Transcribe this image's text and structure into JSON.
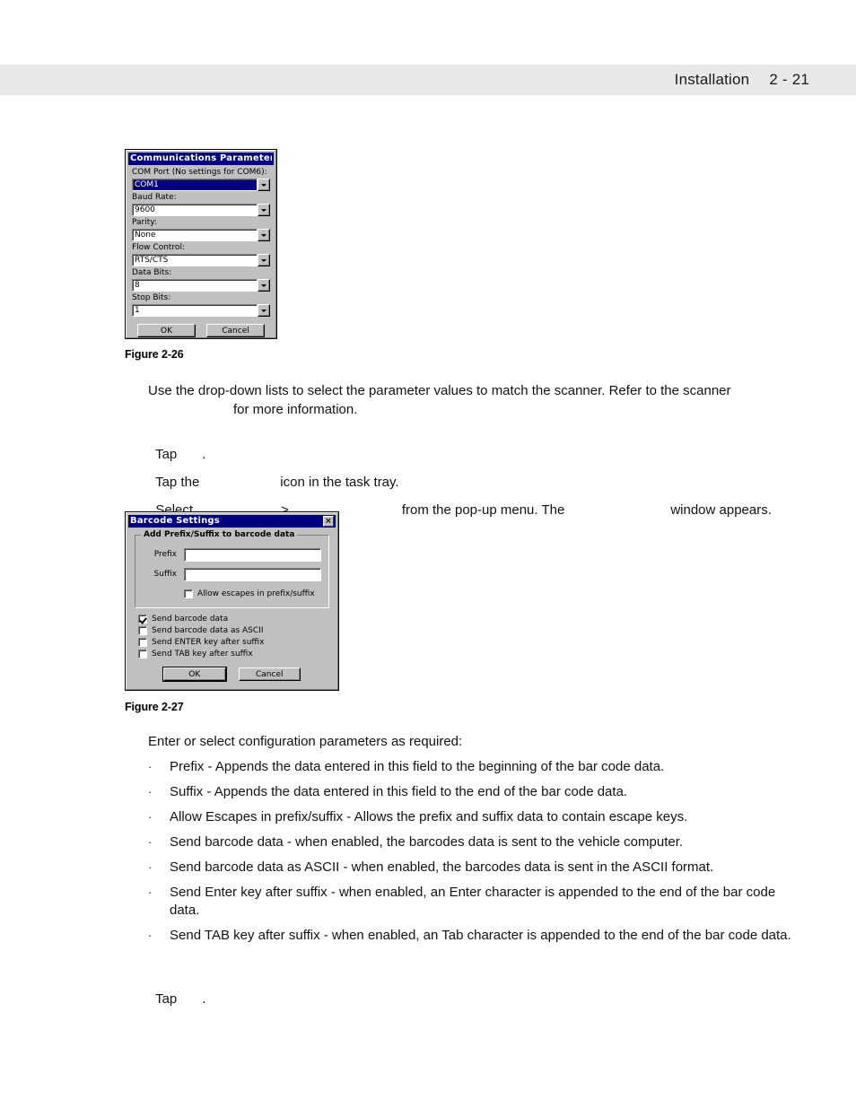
{
  "header": {
    "title": "Installation",
    "folio": "2 - 21"
  },
  "figure_comms": {
    "caption": "Figure 2-26",
    "titlebar": "Communications Parameters",
    "fields": [
      {
        "label": "COM Port (No settings for COM6):",
        "value": "COM1",
        "selected": true
      },
      {
        "label": "Baud Rate:",
        "value": "9600",
        "selected": false
      },
      {
        "label": "Parity:",
        "value": "None",
        "selected": false
      },
      {
        "label": "Flow Control:",
        "value": "RTS/CTS",
        "selected": false
      },
      {
        "label": "Data Bits:",
        "value": "8",
        "selected": false
      },
      {
        "label": "Stop Bits:",
        "value": "1",
        "selected": false
      }
    ],
    "buttons": {
      "ok": "OK",
      "cancel": "Cancel"
    }
  },
  "figure_barcode": {
    "caption": "Figure 2-27",
    "titlebar": "Barcode Settings",
    "close_glyph": "×",
    "group_title": "Add Prefix/Suffix to barcode data",
    "prefix_label": "Prefix",
    "prefix_value": "",
    "suffix_label": "Suffix",
    "suffix_value": "",
    "allow_escapes_label": "Allow escapes in prefix/suffix",
    "allow_escapes_checked": false,
    "checkboxes": [
      {
        "label": "Send barcode data",
        "checked": true
      },
      {
        "label": "Send barcode data as ASCII",
        "checked": false
      },
      {
        "label": "Send ENTER key after suffix",
        "checked": false
      },
      {
        "label": "Send TAB key after suffix",
        "checked": false
      }
    ],
    "buttons": {
      "ok": "OK",
      "cancel": "Cancel"
    }
  },
  "body": {
    "para_comms_line1": "Use the drop-down lists to select the parameter values to match the scanner. Refer to the scanner",
    "para_comms_line2": "for more information.",
    "step_tap_1_pre": "Tap",
    "step_tap_1_post": ".",
    "step_tap_icon_pre": "Tap the",
    "step_tap_icon_post": "icon in the task tray.",
    "step_select_pre": "Select",
    "step_select_mid": ">",
    "step_select_post": "from the pop-up menu. The",
    "step_select_tail": "window appears.",
    "para_enter_select": "Enter or select configuration parameters as required:",
    "bullet_marker": "·",
    "bullets": [
      "Prefix - Appends the data entered in this field to the beginning of the bar code data.",
      "Suffix - Appends the data entered in this field to the end of the bar code data.",
      "Allow Escapes in prefix/suffix - Allows the prefix and suffix data to contain escape keys.",
      "Send barcode data - when enabled, the barcodes data is sent to the vehicle computer.",
      "Send barcode data as ASCII - when enabled, the barcodes data is sent in the ASCII format.",
      "Send Enter key after suffix - when enabled, an Enter character is appended to the end of the bar code data.",
      "Send TAB key after suffix - when enabled, an Tab character is appended to the end of the bar code data."
    ],
    "step_tap_last_pre": "Tap",
    "step_tap_last_post": "."
  }
}
